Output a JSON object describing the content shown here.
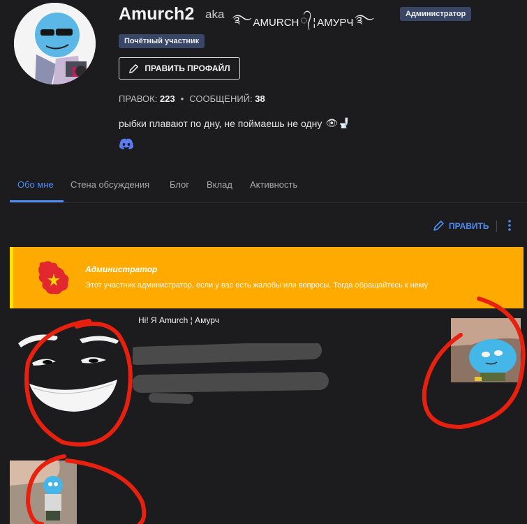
{
  "profile": {
    "username": "Amurch2",
    "aka": "aka",
    "alt_name_latin": "AMURCH",
    "alt_name_separator": "¦",
    "alt_name_cyrillic": "АМУРЧ",
    "badge_admin": "Администратор",
    "badge_member": "Почётный участник",
    "edit_profile": "ПРАВИТЬ ПРОФАЙЛ",
    "edits_label": "ПРАВОК:",
    "edits_value": "223",
    "messages_label": "СООБЩЕНИЙ:",
    "messages_value": "38",
    "bio": "рыбки плавают по дну, не поймаешь не одну",
    "bio_emoji": "👁🚽"
  },
  "tabs": [
    {
      "label": "Обо мне",
      "active": true
    },
    {
      "label": "Стена обсуждения",
      "active": false
    },
    {
      "label": "Блог",
      "active": false
    },
    {
      "label": "Вклад",
      "active": false
    },
    {
      "label": "Активность",
      "active": false
    }
  ],
  "actions": {
    "edit_label": "ПРАВИТЬ"
  },
  "banner": {
    "title": "Администратор",
    "text": "Этот участник администратор, если у вас есть жалобы или вопросы. Тогда обращайтесь к нему",
    "color": "#ffaa00"
  },
  "content": {
    "greeting": "Hi! Я Amurch ¦ Амурч"
  },
  "colors": {
    "accent": "#4d8df4",
    "background": "#1c1b1d",
    "annotation": "#e8200f"
  }
}
